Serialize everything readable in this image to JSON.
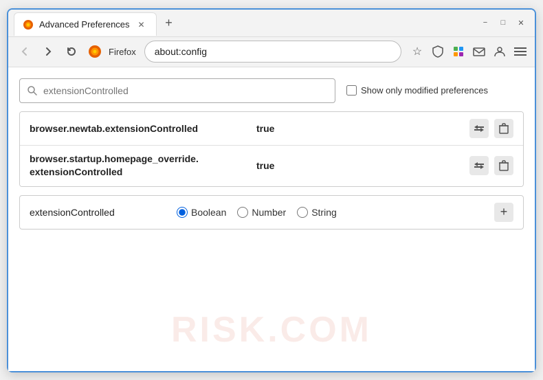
{
  "window": {
    "title": "Advanced Preferences",
    "tab_label": "Advanced Preferences",
    "new_tab_icon": "+",
    "minimize_icon": "−",
    "maximize_icon": "□",
    "close_icon": "✕"
  },
  "navbar": {
    "back_label": "←",
    "forward_label": "→",
    "reload_label": "↻",
    "firefox_label": "Firefox",
    "url": "about:config",
    "bookmark_icon": "☆",
    "shield_icon": "🛡",
    "extension_icon": "🧩",
    "menu_icon": "≡"
  },
  "search": {
    "placeholder": "extensionControlled",
    "value": "extensionControlled",
    "show_modified_label": "Show only modified preferences"
  },
  "results": [
    {
      "name": "browser.newtab.extensionControlled",
      "value": "true"
    },
    {
      "name": "browser.startup.homepage_override.\nextensionControlled",
      "name_line1": "browser.startup.homepage_override.",
      "name_line2": "extensionControlled",
      "value": "true",
      "multiline": true
    }
  ],
  "add_row": {
    "pref_name": "extensionControlled",
    "types": [
      {
        "label": "Boolean",
        "value": "boolean",
        "checked": true
      },
      {
        "label": "Number",
        "value": "number",
        "checked": false
      },
      {
        "label": "String",
        "value": "string",
        "checked": false
      }
    ],
    "add_icon": "+"
  },
  "watermark": "RISK.COM"
}
